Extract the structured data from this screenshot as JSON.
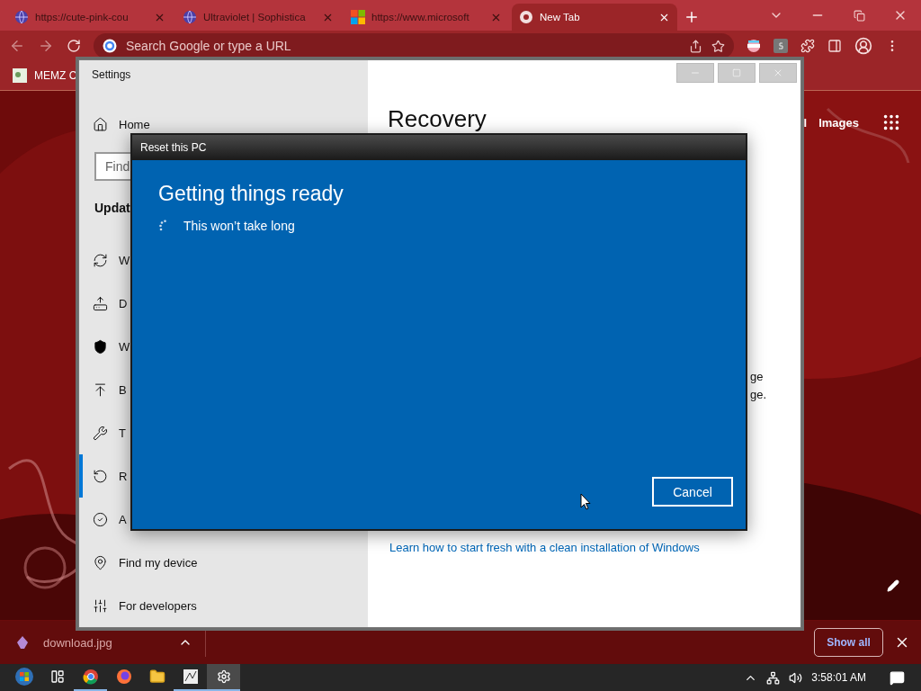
{
  "browser": {
    "tabs": [
      {
        "title": "https://cute-pink-cou",
        "kind": "globe",
        "selected": false
      },
      {
        "title": "Ultraviolet | Sophistica",
        "kind": "globe",
        "selected": false
      },
      {
        "title": "https://www.microsoft",
        "kind": "windows",
        "selected": false
      },
      {
        "title": "New Tab",
        "kind": "chrome",
        "selected": true
      }
    ],
    "address_bar": {
      "placeholder": "Search Google or type a URL"
    },
    "bookmarks": [
      {
        "label": "MEMZ C"
      }
    ],
    "page_links": [
      "l",
      "Images"
    ]
  },
  "settings_window": {
    "title": "Settings",
    "nav": {
      "home": "Home",
      "search_placeholder": "Find",
      "section": "Updat",
      "items": [
        {
          "label": "W",
          "kind": "sync",
          "selected": false
        },
        {
          "label": "D",
          "kind": "delivery",
          "selected": false
        },
        {
          "label": "W",
          "kind": "shield",
          "selected": false
        },
        {
          "label": "B",
          "kind": "backup",
          "selected": false
        },
        {
          "label": "T",
          "kind": "wrench",
          "selected": false
        },
        {
          "label": "R",
          "kind": "recovery",
          "selected": true
        },
        {
          "label": "A",
          "kind": "check",
          "selected": false
        },
        {
          "label": "Find my device",
          "kind": "locate",
          "selected": false
        },
        {
          "label": "For developers",
          "kind": "developers",
          "selected": false
        }
      ]
    },
    "content": {
      "heading": "Recovery",
      "fragments": [
        "ge",
        "ge."
      ],
      "link": "Learn how to start fresh with a clean installation of Windows"
    }
  },
  "dialog": {
    "title": "Reset this PC",
    "heading": "Getting things ready",
    "status": "This won’t take long",
    "button": "Cancel"
  },
  "download_bar": {
    "file": "download.jpg",
    "show_all": "Show all"
  },
  "taskbar": {
    "apps": [
      {
        "kind": "start",
        "running": false,
        "selected": false
      },
      {
        "kind": "taskview",
        "running": false,
        "selected": false
      },
      {
        "kind": "chrome",
        "running": true,
        "selected": false
      },
      {
        "kind": "firefox",
        "running": false,
        "selected": false
      },
      {
        "kind": "explorer",
        "running": false,
        "selected": false
      },
      {
        "kind": "memz",
        "running": true,
        "selected": false
      },
      {
        "kind": "settings",
        "running": true,
        "selected": true
      }
    ],
    "clock": "3:58:01 AM"
  }
}
